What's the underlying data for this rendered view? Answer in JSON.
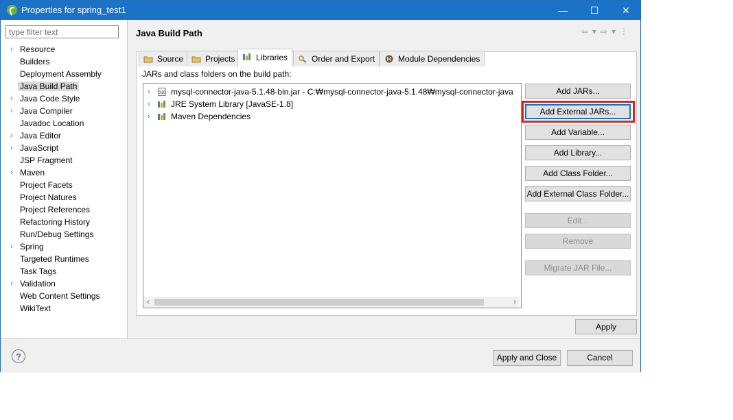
{
  "window": {
    "title": "Properties for spring_test1",
    "minimize": "—",
    "maximize": "☐",
    "close": "✕"
  },
  "filter": {
    "placeholder": "type filter text"
  },
  "tree": [
    {
      "label": "Resource",
      "expandable": true
    },
    {
      "label": "Builders",
      "expandable": false
    },
    {
      "label": "Deployment Assembly",
      "expandable": false
    },
    {
      "label": "Java Build Path",
      "expandable": false,
      "selected": true
    },
    {
      "label": "Java Code Style",
      "expandable": true
    },
    {
      "label": "Java Compiler",
      "expandable": true
    },
    {
      "label": "Javadoc Location",
      "expandable": false
    },
    {
      "label": "Java Editor",
      "expandable": true
    },
    {
      "label": "JavaScript",
      "expandable": true
    },
    {
      "label": "JSP Fragment",
      "expandable": false
    },
    {
      "label": "Maven",
      "expandable": true
    },
    {
      "label": "Project Facets",
      "expandable": false
    },
    {
      "label": "Project Natures",
      "expandable": false
    },
    {
      "label": "Project References",
      "expandable": false
    },
    {
      "label": "Refactoring History",
      "expandable": false
    },
    {
      "label": "Run/Debug Settings",
      "expandable": false
    },
    {
      "label": "Spring",
      "expandable": true
    },
    {
      "label": "Targeted Runtimes",
      "expandable": false
    },
    {
      "label": "Task Tags",
      "expandable": false
    },
    {
      "label": "Validation",
      "expandable": true
    },
    {
      "label": "Web Content Settings",
      "expandable": false
    },
    {
      "label": "WikiText",
      "expandable": false
    }
  ],
  "page": {
    "title": "Java Build Path",
    "tabs": [
      "Source",
      "Projects",
      "Libraries",
      "Order and Export",
      "Module Dependencies"
    ],
    "active_tab": "Libraries",
    "list_label": "JARs and class folders on the build path:",
    "entries": [
      "mysql-connector-java-5.1.48-bin.jar - C:₩mysql-connector-java-5.1.48₩mysql-connector-java",
      "JRE System Library [JavaSE-1.8]",
      "Maven Dependencies"
    ],
    "buttons": {
      "add_jars": "Add JARs...",
      "add_external_jars": "Add External JARs...",
      "add_variable": "Add Variable...",
      "add_library": "Add Library...",
      "add_class_folder": "Add Class Folder...",
      "add_external_class_folder": "Add External Class Folder...",
      "edit": "Edit...",
      "remove": "Remove",
      "migrate_jar": "Migrate JAR File..."
    },
    "apply": "Apply"
  },
  "bottom": {
    "help": "?",
    "apply_and_close": "Apply and Close",
    "cancel": "Cancel"
  },
  "colors": {
    "titlebar": "#1a73c8",
    "highlight": "#e02020",
    "focus": "#0078d7"
  }
}
